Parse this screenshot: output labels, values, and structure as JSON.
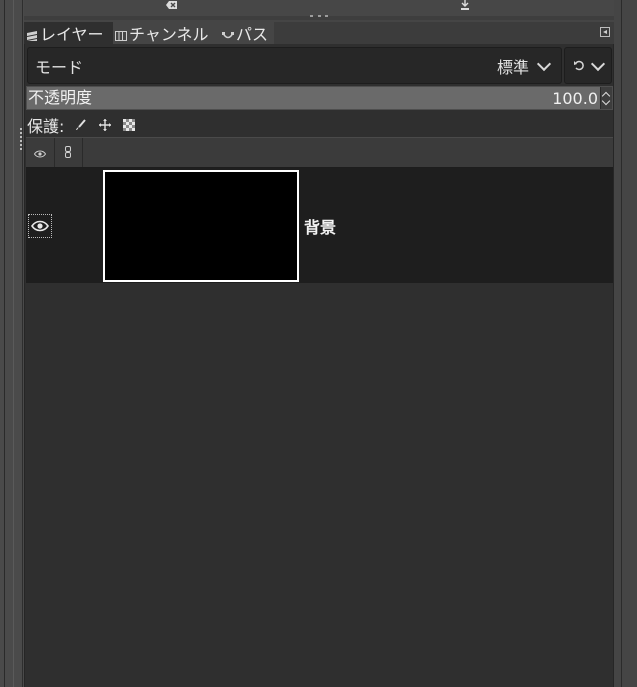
{
  "tabs": [
    {
      "label": "レイヤー",
      "icon": "layers-icon",
      "active": true
    },
    {
      "label": "チャンネル",
      "icon": "channels-icon",
      "active": false
    },
    {
      "label": "パス",
      "icon": "paths-icon",
      "active": false
    }
  ],
  "mode": {
    "label": "モード",
    "value": "標準"
  },
  "opacity": {
    "label": "不透明度",
    "value": "100.0"
  },
  "lock": {
    "label": "保護:"
  },
  "layers": [
    {
      "name": "背景",
      "visible": true
    }
  ],
  "colors": {
    "panel_bg": "#2f2f2f",
    "row_bg": "#1e1e1e",
    "thumb_border": "#ffffff"
  }
}
